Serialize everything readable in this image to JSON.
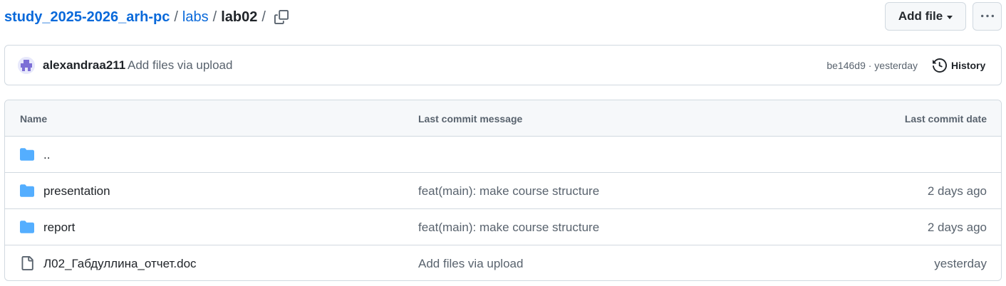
{
  "breadcrumb": {
    "repo": "study_2025-2026_arh-pc",
    "sep1": "/",
    "folder": "labs",
    "sep2": "/",
    "current": "lab02",
    "sep3": "/"
  },
  "actions": {
    "add_file_label": "Add file",
    "more_icon": "kebab-horizontal-icon",
    "copy_icon": "copy-icon"
  },
  "latest_commit": {
    "author": "alexandraa211",
    "message": "Add files via upload",
    "meta": "be146d9 · yesterday",
    "history_label": "History"
  },
  "table": {
    "columns": [
      "Name",
      "Last commit message",
      "Last commit date"
    ],
    "rows": [
      {
        "icon": "folder-icon",
        "name": "..",
        "message": "",
        "date": ""
      },
      {
        "icon": "folder-icon",
        "name": "presentation",
        "message": "feat(main): make course structure",
        "date": "2 days ago"
      },
      {
        "icon": "folder-icon",
        "name": "report",
        "message": "feat(main): make course structure",
        "date": "2 days ago"
      },
      {
        "icon": "file-icon",
        "name": "Л02_Габдуллина_отчет.doc",
        "message": "Add files via upload",
        "date": "yesterday"
      }
    ]
  },
  "colors": {
    "link": "#0969da",
    "folder": "#54aeff",
    "muted": "#59636e",
    "border": "#d1d9e0",
    "header_bg": "#f6f8fa"
  }
}
